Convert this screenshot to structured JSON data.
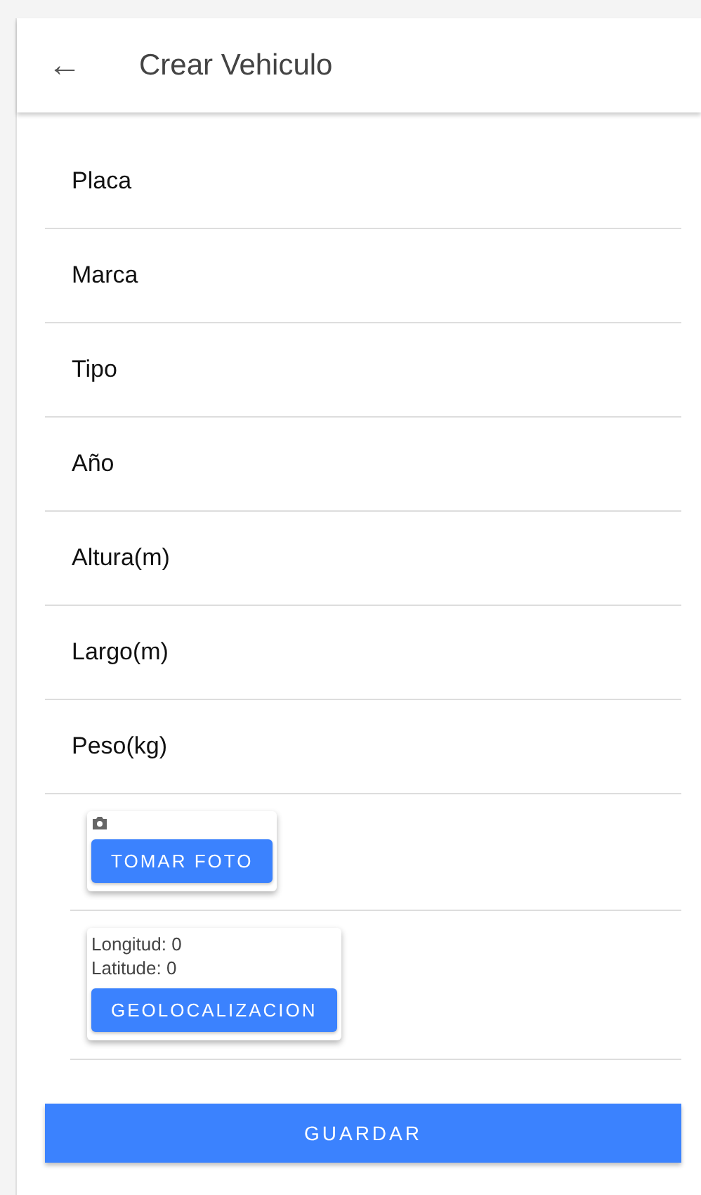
{
  "header": {
    "back_icon": "←",
    "title": "Crear Vehiculo"
  },
  "fields": [
    {
      "placeholder": "Placa"
    },
    {
      "placeholder": "Marca"
    },
    {
      "placeholder": "Tipo"
    },
    {
      "placeholder": "Año"
    },
    {
      "placeholder": "Altura(m)"
    },
    {
      "placeholder": "Largo(m)"
    },
    {
      "placeholder": "Peso(kg)"
    }
  ],
  "photo_card": {
    "button": "TOMAR FOTO"
  },
  "location_card": {
    "longitude": "Longitud: 0",
    "latitude": "Latitude: 0",
    "button": "GEOLOCALIZACION"
  },
  "save_button": "GUARDAR"
}
